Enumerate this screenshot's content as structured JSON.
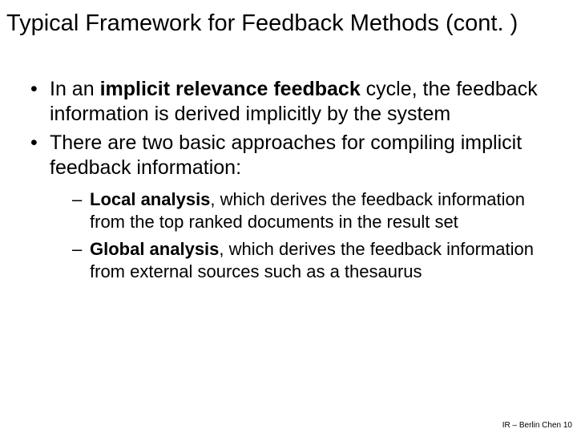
{
  "title": "Typical Framework for Feedback Methods (cont. )",
  "bullets": {
    "b1_pre": "In an ",
    "b1_bold": "implicit relevance feedback",
    "b1_post": " cycle, the feedback information is derived implicitly by the system",
    "b2": "There are two basic approaches for compiling implicit feedback information:",
    "sub1_bold": "Local analysis",
    "sub1_rest": ", which derives the feedback information from the top ranked documents in the result set",
    "sub2_bold": "Global analysis",
    "sub2_rest": ", which derives the feedback information from external sources such as a thesaurus"
  },
  "footer": "IR – Berlin Chen 10"
}
